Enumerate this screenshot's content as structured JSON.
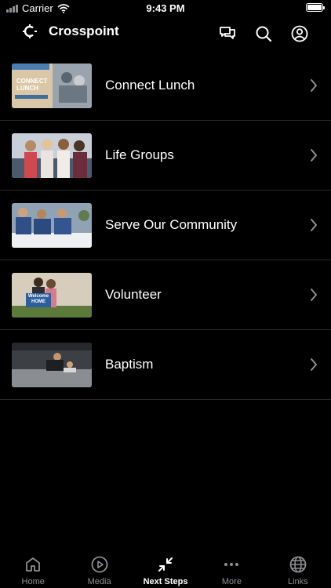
{
  "status_bar": {
    "carrier": "Carrier",
    "time": "9:43 PM"
  },
  "header": {
    "title": "Crosspoint",
    "icons": [
      "chat-icon",
      "search-icon",
      "profile-icon"
    ]
  },
  "list": {
    "items": [
      {
        "label": "Connect Lunch",
        "thumb_text": "CONNECT LUNCH"
      },
      {
        "label": "Life Groups"
      },
      {
        "label": "Serve Our Community"
      },
      {
        "label": "Volunteer",
        "thumb_text": "Welcome HOME"
      },
      {
        "label": "Baptism"
      }
    ]
  },
  "tabbar": {
    "tabs": [
      {
        "label": "Home",
        "icon": "home-icon"
      },
      {
        "label": "Media",
        "icon": "play-icon"
      },
      {
        "label": "Next Steps",
        "icon": "next-steps-icon",
        "active": true
      },
      {
        "label": "More",
        "icon": "more-icon"
      },
      {
        "label": "Links",
        "icon": "globe-icon"
      }
    ]
  },
  "colors": {
    "background": "#000000",
    "separator": "#2a2a2a",
    "inactive": "#8e8e93",
    "active": "#ffffff"
  }
}
